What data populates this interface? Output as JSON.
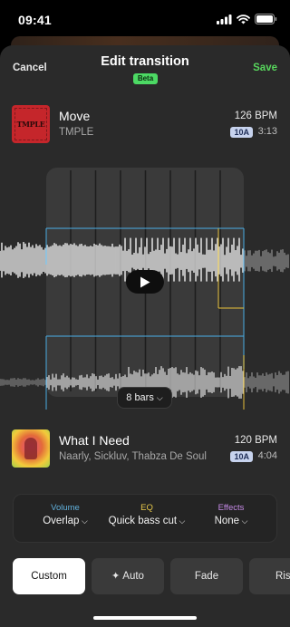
{
  "status": {
    "time": "09:41"
  },
  "header": {
    "cancel": "Cancel",
    "title": "Edit transition",
    "badge": "Beta",
    "save": "Save"
  },
  "track1": {
    "cover_text": "TMPLE",
    "title": "Move",
    "artist": "TMPLE",
    "bpm": "126 BPM",
    "key": "10A",
    "duration": "3:13"
  },
  "waveform": {
    "bars_label": "8 bars",
    "colors": {
      "volume": "#4aa3d6",
      "eq": "#d8b53a"
    }
  },
  "track2": {
    "title": "What I Need",
    "artist": "Naarly, Sickluv, Thabza De Soul",
    "bpm": "120 BPM",
    "key": "10A",
    "duration": "4:04"
  },
  "controls": {
    "volume": {
      "label": "Volume",
      "value": "Overlap",
      "color": "#61b1dd"
    },
    "eq": {
      "label": "EQ",
      "value": "Quick bass cut",
      "color": "#e7c84a"
    },
    "effects": {
      "label": "Effects",
      "value": "None",
      "color": "#c58ae6"
    }
  },
  "modes": {
    "custom": "Custom",
    "auto": "Auto",
    "fade": "Fade",
    "rise": "Ris"
  }
}
